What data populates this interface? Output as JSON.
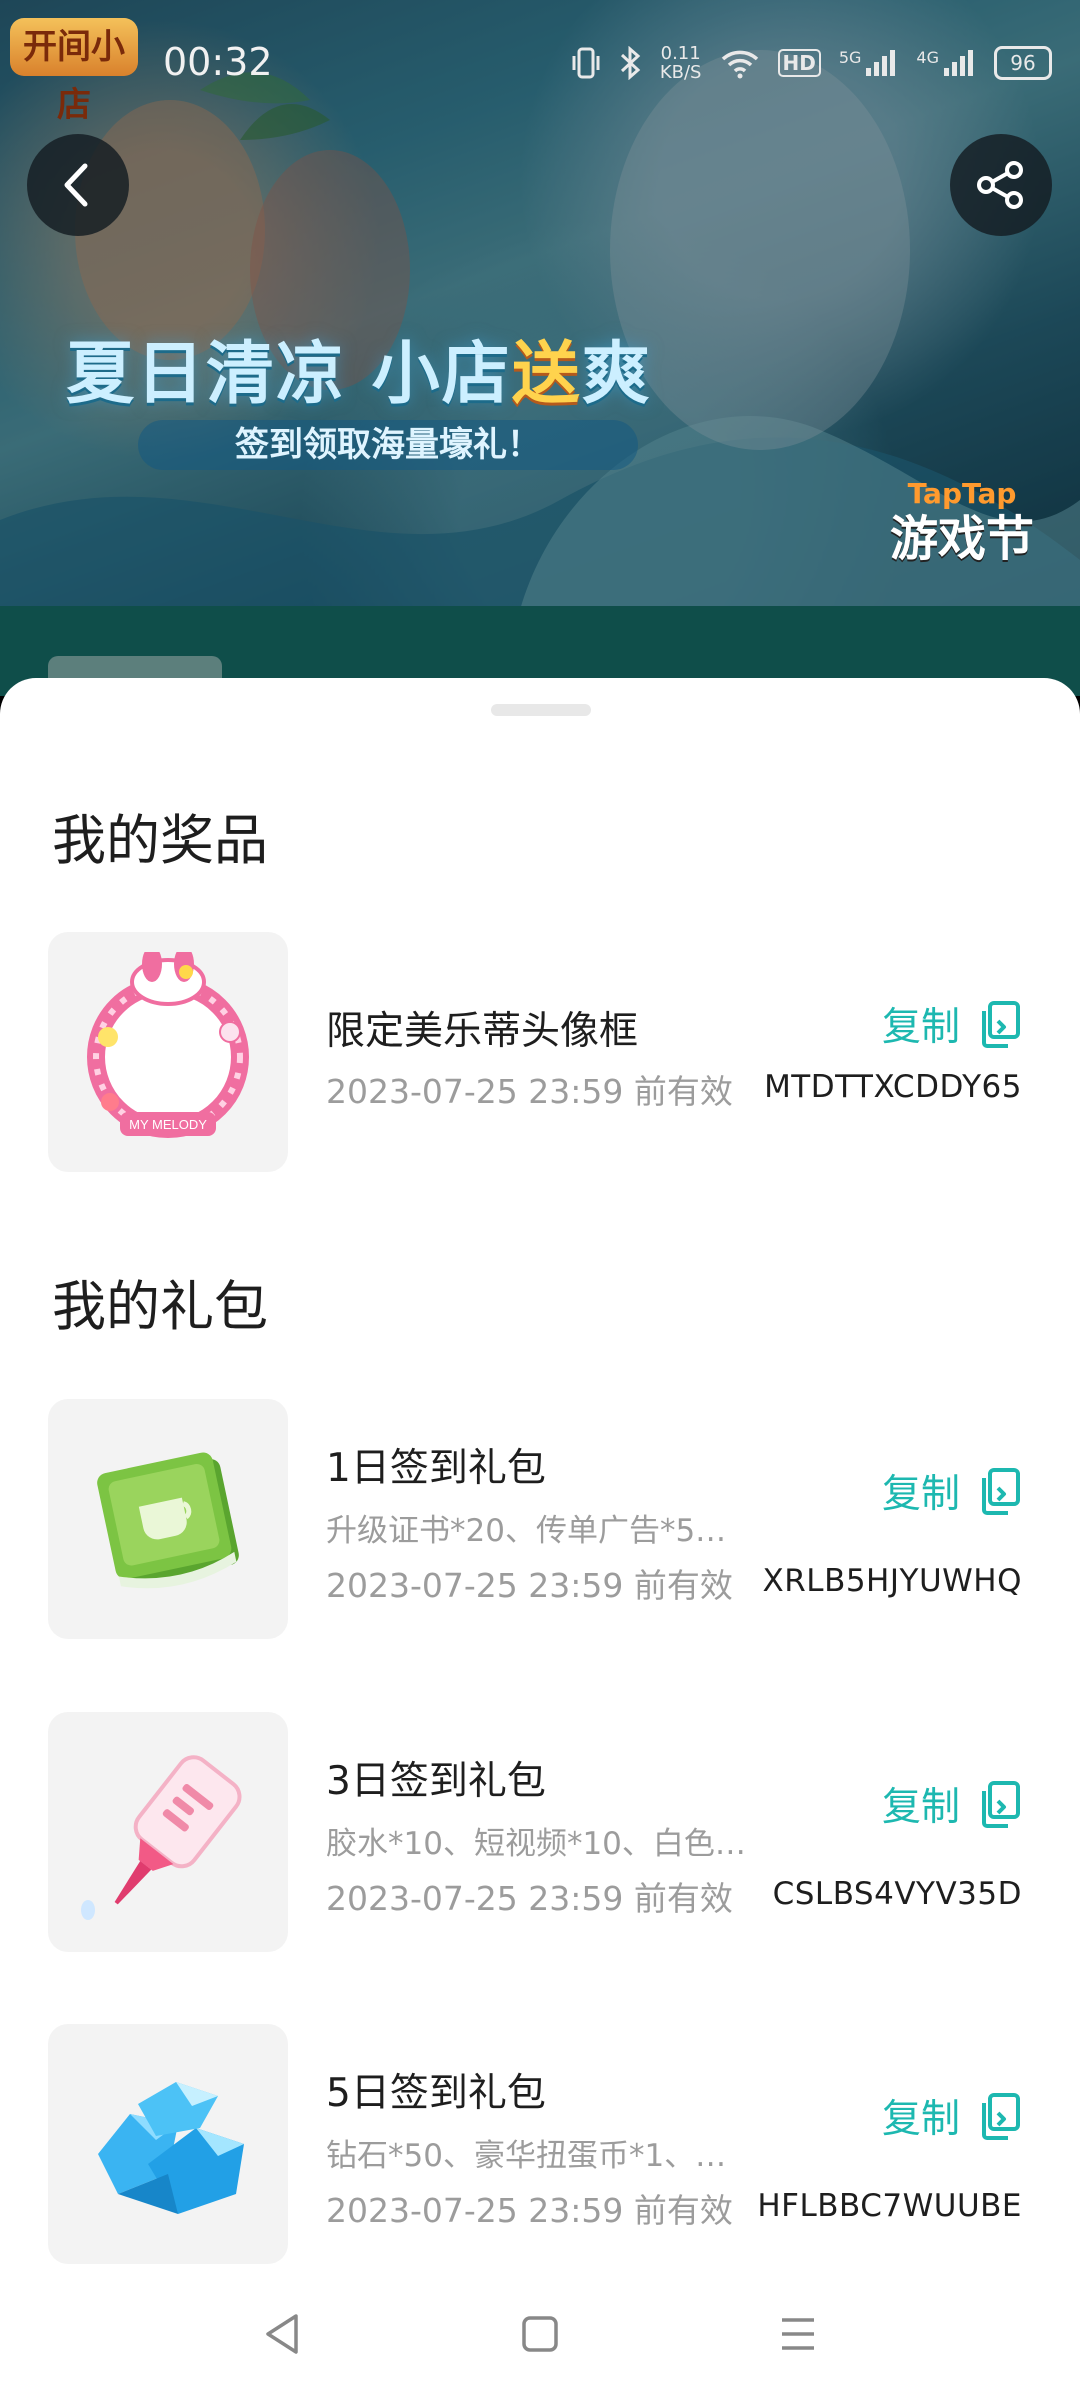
{
  "status_bar": {
    "app_logo_text": "开间小店",
    "time": "00:32",
    "net_speed_value": "0.11",
    "net_speed_unit": "KB/S",
    "hd_label": "HD",
    "sig1_label": "5G",
    "sig2_label": "4G",
    "battery": "96"
  },
  "banner": {
    "title_part1": "夏日清凉 小店",
    "title_accent": "送",
    "title_part2": "爽",
    "subtitle": "签到领取海量壕礼！",
    "festival_line1": "TapTap",
    "festival_line2": "游戏节"
  },
  "prizes": {
    "title": "我的奖品",
    "items": [
      {
        "name": "限定美乐蒂头像框",
        "date": "2023-07-25 23:59 前有效",
        "copy_label": "复制",
        "code": "MTDTTXCDDY65",
        "image": "my-melody-frame"
      }
    ]
  },
  "gifts": {
    "title": "我的礼包",
    "items": [
      {
        "name": "1日签到礼包",
        "desc": "升级证书*20、传单广告*5…",
        "date": "2023-07-25 23:59 前有效",
        "copy_label": "复制",
        "code": "XRLB5HJYUWHQ",
        "image": "certificate"
      },
      {
        "name": "3日签到礼包",
        "desc": "胶水*10、短视频*10、白色…",
        "date": "2023-07-25 23:59 前有效",
        "copy_label": "复制",
        "code": "CSLBS4VYV35D",
        "image": "glue"
      },
      {
        "name": "5日签到礼包",
        "desc": "钻石*50、豪华扭蛋币*1、…",
        "date": "2023-07-25 23:59 前有效",
        "copy_label": "复制",
        "code": "HFLBBC7WUUBE",
        "image": "diamonds"
      }
    ]
  },
  "colors": {
    "accent": "#1db8b0",
    "text": "#1e1e1e",
    "muted": "#9c9c9c"
  }
}
